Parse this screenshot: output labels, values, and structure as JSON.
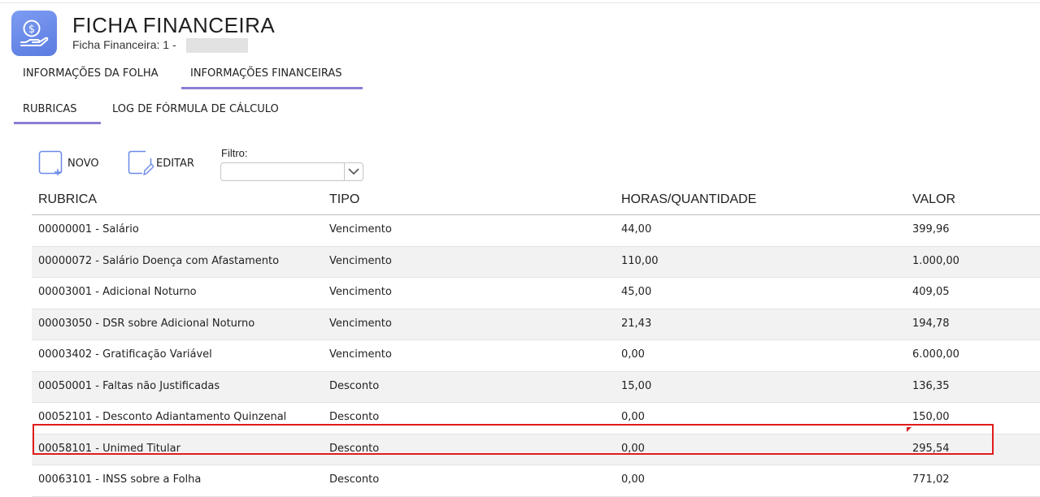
{
  "header": {
    "title": "FICHA FINANCEIRA",
    "subtitle": "Ficha Financeira: 1 -",
    "icon": "money-hand-icon"
  },
  "tabs_main": [
    {
      "label": "INFORMAÇÕES DA FOLHA",
      "active": false
    },
    {
      "label": "INFORMAÇÕES FINANCEIRAS",
      "active": true
    }
  ],
  "tabs_sub": [
    {
      "label": "RUBRICAS",
      "active": true
    },
    {
      "label": "LOG DE FÓRMULA DE CÁLCULO",
      "active": false
    }
  ],
  "toolbar": {
    "novo_label": "NOVO",
    "editar_label": "EDITAR",
    "filtro_label": "Filtro:",
    "filtro_value": ""
  },
  "table": {
    "columns": [
      "RUBRICA",
      "TIPO",
      "HORAS/QUANTIDADE",
      "VALOR"
    ],
    "rows": [
      [
        "00000001 - Salário",
        "Vencimento",
        "44,00",
        "399,96"
      ],
      [
        "00000072 - Salário Doença com Afastamento",
        "Vencimento",
        "110,00",
        "1.000,00"
      ],
      [
        "00003001 - Adicional Noturno",
        "Vencimento",
        "45,00",
        "409,05"
      ],
      [
        "00003050 - DSR sobre Adicional Noturno",
        "Vencimento",
        "21,43",
        "194,78"
      ],
      [
        "00003402 - Gratificação Variável",
        "Vencimento",
        "0,00",
        "6.000,00"
      ],
      [
        "00050001 - Faltas não Justificadas",
        "Desconto",
        "15,00",
        "136,35"
      ],
      [
        "00052101 - Desconto Adiantamento Quinzenal",
        "Desconto",
        "0,00",
        "150,00"
      ],
      [
        "00058101 - Unimed Titular",
        "Desconto",
        "0,00",
        "295,54"
      ],
      [
        "00063101 - INSS sobre a Folha",
        "Desconto",
        "0,00",
        "771,02"
      ]
    ],
    "highlighted_row": 7
  },
  "colors": {
    "accent": "#8a7fd4",
    "icon_bg": "#6a89e8",
    "highlight": "#e01b1b"
  }
}
